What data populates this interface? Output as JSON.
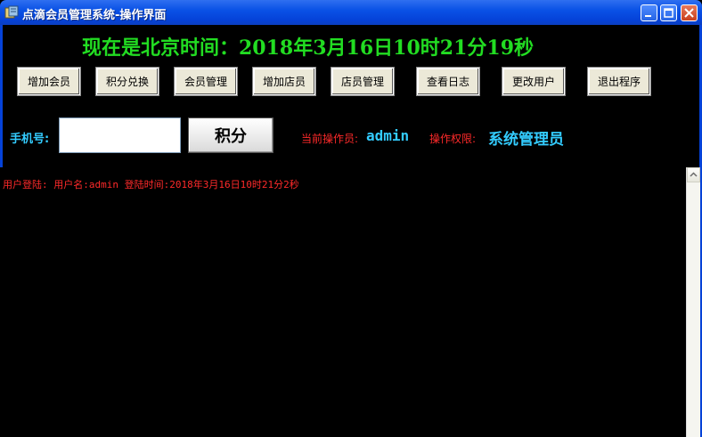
{
  "window": {
    "title": "点滴会员管理系统-操作界面",
    "icon": "app-icon"
  },
  "clock": {
    "text": "现在是北京时间：2018年3月16日10时21分19秒"
  },
  "toolbar": {
    "buttons": [
      {
        "label": "增加会员"
      },
      {
        "label": "积分兑换"
      },
      {
        "label": "会员管理"
      },
      {
        "label": "增加店员"
      },
      {
        "label": "店员管理"
      },
      {
        "label": "查看日志"
      },
      {
        "label": "更改用户"
      },
      {
        "label": "退出程序"
      }
    ]
  },
  "points": {
    "phone_label": "手机号:",
    "phone_value": "",
    "button_label": "积分"
  },
  "operator": {
    "label": "当前操作员:",
    "value": "admin",
    "perm_label": "操作权限:",
    "perm_value": "系统管理员"
  },
  "log": {
    "line": "用户登陆:  用户名:admin  登陆时间:2018年3月16日10时21分2秒"
  },
  "colors": {
    "clock": "#22dd22",
    "cyan": "#33ccff",
    "red": "#ff2a2a",
    "titlebar": "#0a52e6"
  }
}
